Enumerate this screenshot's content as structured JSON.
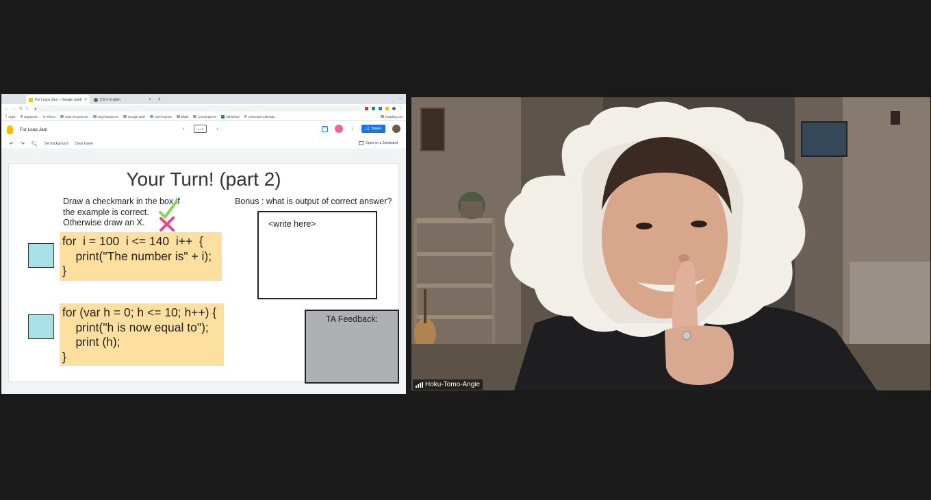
{
  "browser": {
    "tabs": [
      {
        "title": "For Loops Jam – Google Jamb..."
      },
      {
        "title": "CS in English"
      }
    ],
    "new_tab": "+",
    "bookmarks": [
      "Apps",
      "Bugzenon",
      "Filters",
      "Team Resources",
      "Org Resources",
      "Google-wide",
      "Old Projects",
      "Blokli",
      "Convergence",
      "edmeltoid",
      "Commute Calenda..."
    ],
    "reading_list": "Reading List"
  },
  "jamboard": {
    "title": "For Loop Jam",
    "frame_indicator": "4 / 8",
    "share_label": "Share",
    "tools": {
      "set_background": "Set background",
      "clear_frame": "Clear frame",
      "open_jamboard": "Open on a Jamboard"
    }
  },
  "slide": {
    "title": "Your Turn! (part 2)",
    "instructions": "Draw a checkmark in the box if\nthe example is correct.\nOtherwise draw an X.",
    "bonus": "Bonus : what is output of correct answer?",
    "code1": "for  i = 100  i <= 140  i++  {\n    print(\"The number is\" + i);\n}",
    "code2": "for (var h = 0; h <= 10; h++) {\n    print(\"h is now equal to\");\n    print (h);\n}",
    "answer_placeholder": "<write here>",
    "ta_feedback": "TA Feedback:"
  },
  "colors": {
    "code_bg": "#fde0a0",
    "checkbox_fill": "#a8e2e6",
    "ta_box": "#aeb0b4",
    "share_blue": "#1a73e8",
    "check_green": "#7ed957",
    "x_pink": "#e8458b"
  },
  "participant": {
    "name": "Hoku-Tomo-Angie"
  }
}
